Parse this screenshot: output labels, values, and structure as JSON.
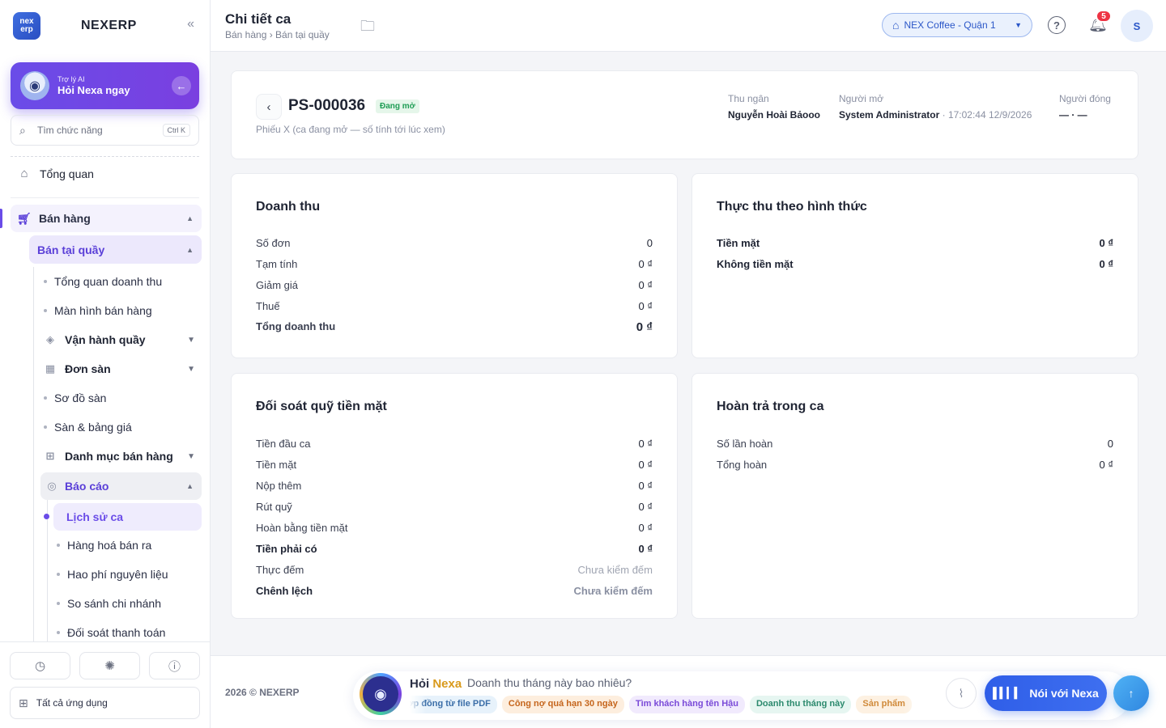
{
  "sidebar": {
    "brand": "NEXERP",
    "logo_text": "nex erp",
    "ai_card": {
      "sub": "Trợ lý AI",
      "main": "Hỏi Nexa ngay"
    },
    "search": {
      "placeholder": "Tìm chức năng",
      "shortcut": "Ctrl K"
    },
    "overview": "Tổng quan",
    "sales_group": "Bán hàng",
    "counter_group": "Bán tại quầy",
    "items": {
      "revenue_overview": "Tổng quan doanh thu",
      "sales_screen": "Màn hình bán hàng",
      "counter_ops": "Vận hành quầy",
      "floor_orders": "Đơn sàn",
      "floor_map": "Sơ đồ sàn",
      "products_prices": "Sàn & bảng giá",
      "catalog": "Danh mục bán hàng",
      "reports": "Báo cáo",
      "shift_history": "Lịch sử ca",
      "goods_sold": "Hàng hoá bán ra",
      "material_cost": "Hao phí nguyên liệu",
      "branch_compare": "So sánh chi nhánh",
      "payment_recon": "Đối soát thanh toán"
    },
    "all_apps": "Tất cả ứng dụng"
  },
  "header": {
    "title": "Chi tiết ca",
    "breadcrumb": "Bán hàng › Bán tại quầy",
    "branch": "NEX Coffee - Quận 1",
    "notification_count": "5",
    "avatar_letter": "S"
  },
  "shift": {
    "code": "PS-000036",
    "status": "Đang mở",
    "note": "Phiếu X (ca đang mở — số tính tới lúc xem)",
    "cashier_label": "Thu ngân",
    "cashier": "Nguyễn Hoài Bảooo",
    "opener_label": "Người mở",
    "opener": "System Administrator",
    "opened_at": "· 17:02:44 12/9/2026",
    "closer_label": "Người đóng",
    "closer": "— · —"
  },
  "revenue": {
    "title": "Doanh thu",
    "rows": [
      {
        "label": "Số đơn",
        "value": "0"
      },
      {
        "label": "Tạm tính",
        "value": "0 ₫"
      },
      {
        "label": "Giảm giá",
        "value": "0 ₫"
      },
      {
        "label": "Thuế",
        "value": "0 ₫"
      },
      {
        "label": "Tổng doanh thu",
        "value": "0 ₫"
      }
    ]
  },
  "payments": {
    "title": "Thực thu theo hình thức",
    "rows": [
      {
        "label": "Tiền mặt",
        "value": "0 ₫"
      },
      {
        "label": "Không tiền mặt",
        "value": "0 ₫"
      }
    ]
  },
  "cash_recon": {
    "title": "Đối soát quỹ tiền mặt",
    "rows": [
      {
        "label": "Tiền đầu ca",
        "value": "0 ₫"
      },
      {
        "label": "Tiền mặt",
        "value": "0 ₫"
      },
      {
        "label": "Nộp thêm",
        "value": "0 ₫"
      },
      {
        "label": "Rút quỹ",
        "value": "0 ₫"
      },
      {
        "label": "Hoàn bằng tiền mặt",
        "value": "0 ₫"
      },
      {
        "label": "Tiền phải có",
        "value": "0 ₫"
      },
      {
        "label": "Thực đếm",
        "value": "Chưa kiểm đếm"
      },
      {
        "label": "Chênh lệch",
        "value": "Chưa kiểm đếm"
      }
    ]
  },
  "refunds": {
    "title": "Hoàn trả trong ca",
    "rows": [
      {
        "label": "Số lần hoàn",
        "value": "0"
      },
      {
        "label": "Tổng hoàn",
        "value": "0 ₫"
      }
    ]
  },
  "footer": {
    "copyright": "2026 © NEXERP",
    "ask_prefix": "Hỏi",
    "ask_name": "Nexa",
    "ask_placeholder": "Doanh thu tháng này bao nhiêu?",
    "chips": [
      "hợp đồng từ file PDF",
      "Công nợ quá hạn 30 ngày",
      "Tìm khách hàng tên Hậu",
      "Doanh thu tháng này",
      "Sản phẩm"
    ],
    "voice_label": "Nói với Nexa"
  },
  "icons": {
    "collapse": "double-chevron-left-icon",
    "home": "home-icon",
    "cart": "cart-icon",
    "layers": "layers-icon",
    "calendar": "calendar-icon",
    "grid": "grid-icon",
    "report": "report-icon",
    "clock": "clock-icon",
    "bug": "bug-icon",
    "alert": "alert-icon",
    "apps": "apps-icon",
    "folder": "folder-icon",
    "store": "store-icon",
    "help": "help-icon",
    "bell": "bell-icon",
    "attach": "paperclip-icon",
    "mic": "voice-bars-icon",
    "send": "send-arrow-icon"
  },
  "colors": {
    "accent": "#6a4ce8",
    "brand_blue": "#2f5ee8",
    "status_open": "#1f9d55",
    "badge": "#ee3344"
  }
}
